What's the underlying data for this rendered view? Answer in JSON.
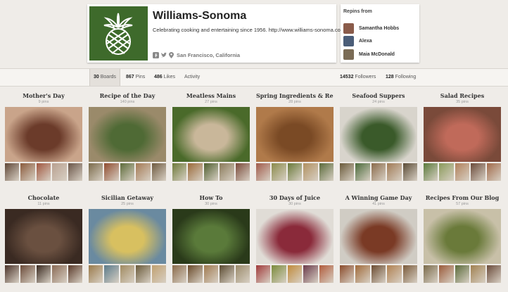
{
  "profile": {
    "name": "Williams-Sonoma",
    "bio": "Celebrating cooking and entertaining since 1956. http://www.williams-sonoma.com",
    "location": "San Francisco, California",
    "logo_color": "#3e6a2b"
  },
  "repins": {
    "title": "Repins from",
    "users": [
      {
        "name": "Samantha Hobbs",
        "avatar_color": "#8a5b4a"
      },
      {
        "name": "Alexa",
        "avatar_color": "#4b5d78"
      },
      {
        "name": "Maia McDonald",
        "avatar_color": "#7a6b55"
      }
    ]
  },
  "stats": {
    "boards": {
      "count": "30",
      "label": "Boards"
    },
    "pins": {
      "count": "867",
      "label": "Pins"
    },
    "likes": {
      "count": "486",
      "label": "Likes"
    },
    "activity": "Activity",
    "followers": {
      "count": "14532",
      "label": "Followers"
    },
    "following": {
      "count": "128",
      "label": "Following"
    }
  },
  "boards": [
    {
      "title": "Mother's Day",
      "count": "9 pins",
      "main": "#c9a48a",
      "main2": "#6b3b2a",
      "thumbs": [
        "#5f4636",
        "#8a5a3b",
        "#a0563f",
        "#b8a090",
        "#6a5548"
      ]
    },
    {
      "title": "Recipe of the Day",
      "count": "140 pins",
      "main": "#9a8a6a",
      "main2": "#4f6a35",
      "thumbs": [
        "#7a6a4a",
        "#8f4b2e",
        "#5d6b3a",
        "#a47a55",
        "#6e5a40"
      ]
    },
    {
      "title": "Meatless Mains",
      "count": "27 pins",
      "main": "#4a6a2a",
      "main2": "#c9b79a",
      "thumbs": [
        "#6d7a3a",
        "#9a6a3a",
        "#4e5e2e",
        "#8a7a5a",
        "#7a4a3a"
      ]
    },
    {
      "title": "Spring Ingredients & Re...",
      "count": "28 pins",
      "main": "#b07a4a",
      "main2": "#7a4a25",
      "thumbs": [
        "#a05a4a",
        "#8a8a4a",
        "#6a7a3a",
        "#b09060",
        "#5a6a3a"
      ]
    },
    {
      "title": "Seafood Suppers",
      "count": "24 pins",
      "main": "#d8d4cc",
      "main2": "#3a5a2a",
      "thumbs": [
        "#6a5a3a",
        "#4a6a3a",
        "#8a6a4a",
        "#a07a55",
        "#5a4a35"
      ]
    },
    {
      "title": "Salad Recipes",
      "count": "35 pins",
      "main": "#7a4a3a",
      "main2": "#c06a5a",
      "thumbs": [
        "#5a7a3a",
        "#8a9a5a",
        "#b0805a",
        "#6a4a3a",
        "#a06a4a"
      ]
    },
    {
      "title": "Chocolate",
      "count": "11 pins",
      "main": "#3a2a22",
      "main2": "#6a5040",
      "thumbs": [
        "#4a3228",
        "#6a4a38",
        "#3a2a20",
        "#8a6a55",
        "#5a3a2a"
      ]
    },
    {
      "title": "Sicilian Getaway",
      "count": "25 pins",
      "main": "#6a8aa0",
      "main2": "#d8c060",
      "thumbs": [
        "#9a7a4a",
        "#5a7a8a",
        "#a08a60",
        "#6a5a3a",
        "#c0a070"
      ]
    },
    {
      "title": "How To",
      "count": "30 pins",
      "main": "#2a3a1a",
      "main2": "#5a7a3a",
      "thumbs": [
        "#8a6a4a",
        "#6a4a2a",
        "#a07a50",
        "#5a4a30",
        "#9a8a6a"
      ]
    },
    {
      "title": "30 Days of Juice",
      "count": "30 pins",
      "main": "#e0dcd6",
      "main2": "#8a2a3a",
      "thumbs": [
        "#a03a3a",
        "#7a8a3a",
        "#c08a3a",
        "#6a3a4a",
        "#b05a3a"
      ]
    },
    {
      "title": "A Winning Game Day",
      "count": "41 pins",
      "main": "#d0ccc4",
      "main2": "#7a3a25",
      "thumbs": [
        "#8a4a2a",
        "#a06a3a",
        "#6a4a30",
        "#b08050",
        "#7a5a3a"
      ]
    },
    {
      "title": "Recipes From Our Blog",
      "count": "57 pins",
      "main": "#c8c0a8",
      "main2": "#6a7a3a",
      "thumbs": [
        "#7a6a4a",
        "#9a5a3a",
        "#5a6a3a",
        "#a08050",
        "#6a4a3a"
      ]
    }
  ]
}
